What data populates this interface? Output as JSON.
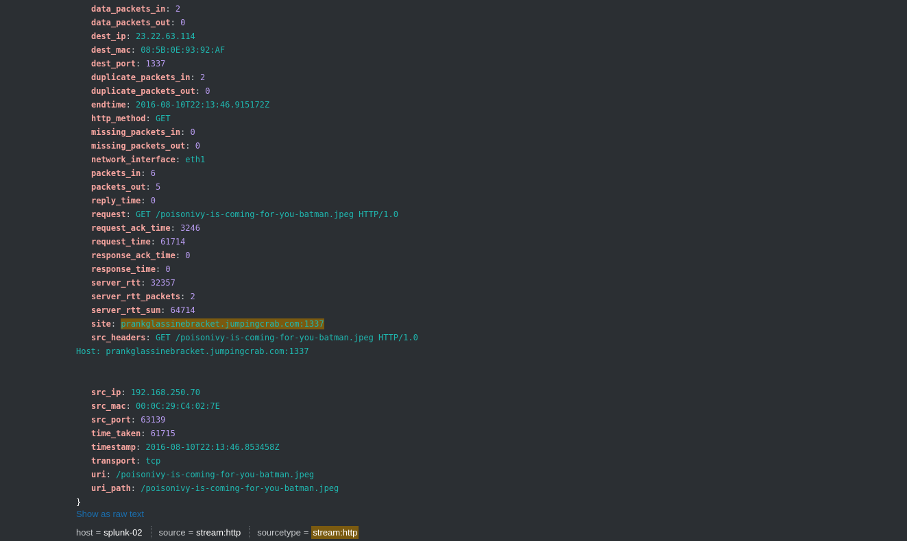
{
  "event_fields": [
    {
      "key": "data_packets_in",
      "value": "2",
      "type": "num"
    },
    {
      "key": "data_packets_out",
      "value": "0",
      "type": "num"
    },
    {
      "key": "dest_ip",
      "value": "23.22.63.114",
      "type": "str"
    },
    {
      "key": "dest_mac",
      "value": "08:5B:0E:93:92:AF",
      "type": "str"
    },
    {
      "key": "dest_port",
      "value": "1337",
      "type": "num"
    },
    {
      "key": "duplicate_packets_in",
      "value": "2",
      "type": "num"
    },
    {
      "key": "duplicate_packets_out",
      "value": "0",
      "type": "num"
    },
    {
      "key": "endtime",
      "value": "2016-08-10T22:13:46.915172Z",
      "type": "str"
    },
    {
      "key": "http_method",
      "value": "GET",
      "type": "str"
    },
    {
      "key": "missing_packets_in",
      "value": "0",
      "type": "num"
    },
    {
      "key": "missing_packets_out",
      "value": "0",
      "type": "num"
    },
    {
      "key": "network_interface",
      "value": "eth1",
      "type": "str"
    },
    {
      "key": "packets_in",
      "value": "6",
      "type": "num"
    },
    {
      "key": "packets_out",
      "value": "5",
      "type": "num"
    },
    {
      "key": "reply_time",
      "value": "0",
      "type": "num"
    },
    {
      "key": "request",
      "value": "GET /poisonivy-is-coming-for-you-batman.jpeg HTTP/1.0",
      "type": "str"
    },
    {
      "key": "request_ack_time",
      "value": "3246",
      "type": "num"
    },
    {
      "key": "request_time",
      "value": "61714",
      "type": "num"
    },
    {
      "key": "response_ack_time",
      "value": "0",
      "type": "num"
    },
    {
      "key": "response_time",
      "value": "0",
      "type": "num"
    },
    {
      "key": "server_rtt",
      "value": "32357",
      "type": "num"
    },
    {
      "key": "server_rtt_packets",
      "value": "2",
      "type": "num"
    },
    {
      "key": "server_rtt_sum",
      "value": "64714",
      "type": "num"
    },
    {
      "key": "site",
      "value": "prankglassinebracket.jumpingcrab.com:1337",
      "type": "str",
      "highlight": true
    },
    {
      "key": "src_headers",
      "value": "GET /poisonivy-is-coming-for-you-batman.jpeg HTTP/1.0",
      "type": "str"
    },
    {
      "continuation": "Host: prankglassinebracket.jumpingcrab.com:1337"
    },
    {
      "blank": true
    },
    {
      "blank": true
    },
    {
      "key": "src_ip",
      "value": "192.168.250.70",
      "type": "str"
    },
    {
      "key": "src_mac",
      "value": "00:0C:29:C4:02:7E",
      "type": "str"
    },
    {
      "key": "src_port",
      "value": "63139",
      "type": "num"
    },
    {
      "key": "time_taken",
      "value": "61715",
      "type": "num"
    },
    {
      "key": "timestamp",
      "value": "2016-08-10T22:13:46.853458Z",
      "type": "str"
    },
    {
      "key": "transport",
      "value": "tcp",
      "type": "str"
    },
    {
      "key": "uri",
      "value": "/poisonivy-is-coming-for-you-batman.jpeg",
      "type": "str"
    },
    {
      "key": "uri_path",
      "value": "/poisonivy-is-coming-for-you-batman.jpeg",
      "type": "str"
    }
  ],
  "closing_brace": "}",
  "colon": ":",
  "raw_link": "Show as raw text",
  "meta": {
    "host": {
      "key": "host",
      "eq": "=",
      "value": "splunk-02"
    },
    "source": {
      "key": "source",
      "eq": "=",
      "value": "stream:http"
    },
    "sourcetype": {
      "key": "sourcetype",
      "eq": "=",
      "value": "stream:http",
      "highlight": true
    }
  },
  "colors": {
    "background": "#2b2f33",
    "key": "#f6a5a0",
    "number": "#b89cf0",
    "string": "#1fb8b0",
    "highlight": "#7a5a10",
    "link": "#1a6fb0"
  }
}
